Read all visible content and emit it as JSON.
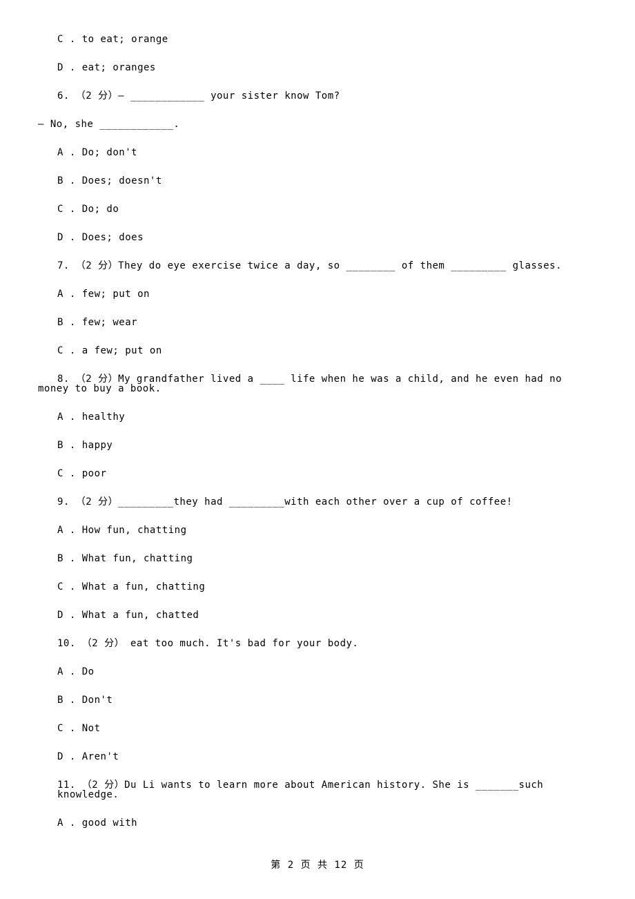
{
  "lines": {
    "l0": "C . to eat; orange",
    "l1": "D . eat; oranges",
    "l2": "6. （2 分）— ____________ your sister know Tom?",
    "l3": "— No, she ____________.",
    "l4": "A . Do; don't",
    "l5": "B . Does; doesn't",
    "l6": "C . Do; do",
    "l7": "D . Does; does",
    "l8": "7. （2 分）They do eye exercise twice a day, so ________ of them _________ glasses.",
    "l9": "A . few; put on",
    "l10": "B . few; wear",
    "l11": "C . a few; put on",
    "l12": "8. （2 分）My grandfather lived a ____ life when he was a child, and he even had no money to buy a book.",
    "l13": "A . healthy",
    "l14": "B . happy",
    "l15": "C . poor",
    "l16": "9. （2 分）_________they had _________with each other over a cup of coffee!",
    "l17": "A . How fun, chatting",
    "l18": "B . What fun, chatting",
    "l19": "C . What a fun, chatting",
    "l20": "D . What a fun, chatted",
    "l21": "10. （2 分）     eat too much. It's bad for your body.",
    "l22": "A . Do",
    "l23": "B . Don't",
    "l24": "C . Not",
    "l25": "D . Aren't",
    "l26": "11. （2 分）Du Li wants to learn more about American history. She is _______such knowledge.",
    "l27": "A . good with"
  },
  "footer": "第 2 页 共 12 页"
}
